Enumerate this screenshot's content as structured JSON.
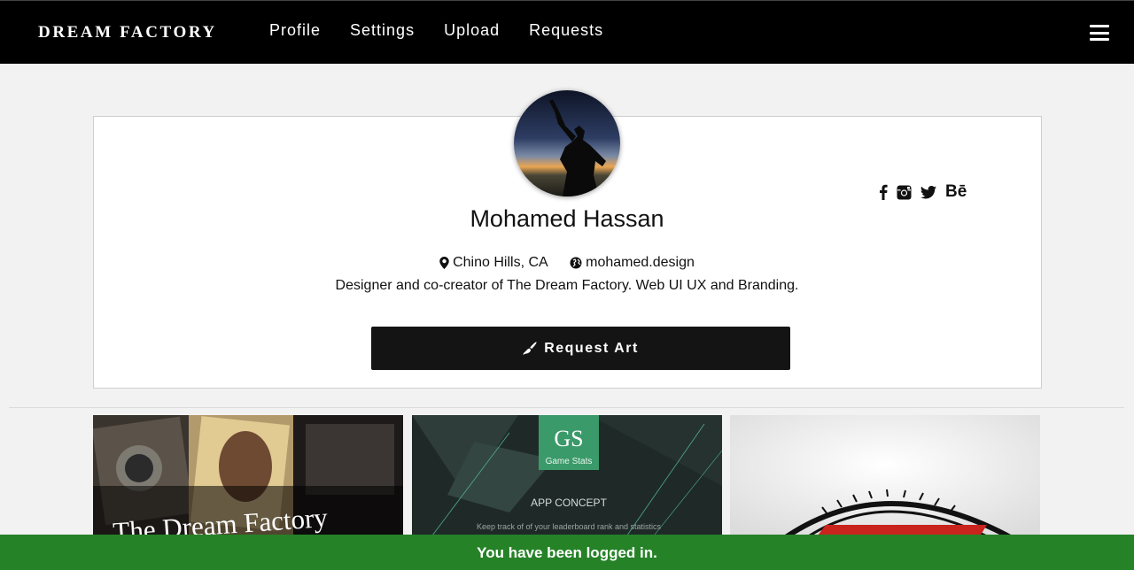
{
  "navbar": {
    "brand": "DREAM FACTORY",
    "links": [
      "Profile",
      "Settings",
      "Upload",
      "Requests"
    ],
    "menu_icon": "hamburger-menu-icon"
  },
  "profile": {
    "name": "Mohamed Hassan",
    "location": "Chino Hills, CA",
    "website": "mohamed.design",
    "bio": "Designer and co-creator of The Dream Factory. Web UI UX and Branding.",
    "request_button": "Request Art",
    "social_icons": [
      "facebook-icon",
      "instagram-icon",
      "twitter-icon",
      "behance-icon"
    ],
    "behance_label": "Bē"
  },
  "gallery": {
    "tile1": {
      "title": "The Dream Factory"
    },
    "tile2": {
      "badge": "GS",
      "badge_sub": "Game Stats",
      "title": "APP CONCEPT",
      "sub": "Keep track of of your leaderboard rank and statistics"
    }
  },
  "toast": {
    "message": "You have been logged in."
  },
  "colors": {
    "navbar": "#000000",
    "toast": "#258227",
    "button": "#141414"
  }
}
